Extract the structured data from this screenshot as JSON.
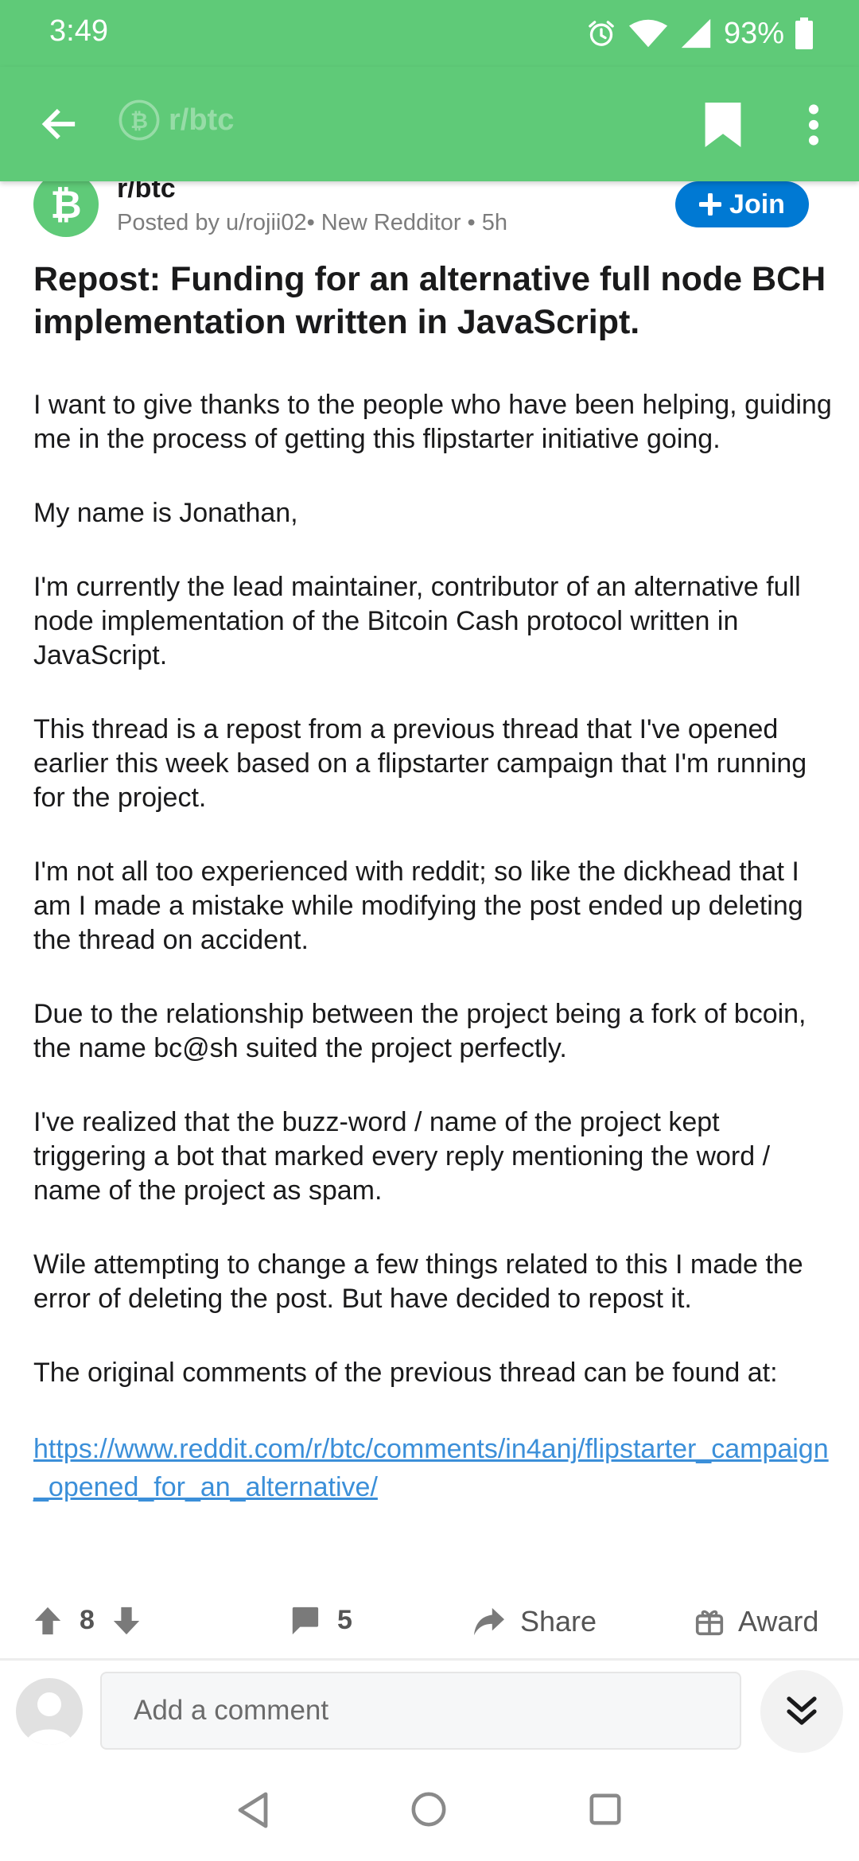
{
  "status_bar": {
    "time": "3:49",
    "battery": "93%",
    "icons": [
      "alarm-icon",
      "wifi-icon",
      "signal-icon",
      "battery-icon"
    ]
  },
  "app_bar": {
    "subreddit_label": "r/btc",
    "icons": [
      "back-arrow-icon",
      "bitcoin-cash-icon",
      "bookmark-icon",
      "more-vert-icon"
    ]
  },
  "post": {
    "subreddit": "r/btc",
    "meta": "Posted by u/rojii02• New Redditor • 5h",
    "join_label": "Join",
    "title": "Repost: Funding for an alternative full node BCH implementation written in JavaScript.",
    "paragraphs": [
      "I want to give thanks to the people who have been helping, guiding me in the process of getting this flipstarter initiative going.",
      "My name is Jonathan,",
      "I'm currently the lead maintainer, contributor of an alternative full node implementation of the Bitcoin Cash protocol written in JavaScript.",
      "This thread is a repost from a previous thread that I've opened earlier this week based on a flipstarter campaign that I'm running for the project.",
      "I'm not all too experienced with reddit; so like the dickhead that I am I made a mistake while modifying the post ended up deleting the thread on accident.",
      "Due to the relationship between the project being a fork of bcoin, the name bc@sh suited the project perfectly.",
      "I've realized that the buzz-word / name of the project kept triggering a bot that marked every reply mentioning the word / name of the project as spam.",
      "Wile attempting to change a few things related to this I made the error of deleting the post. But have decided to repost it.",
      "The original comments of the previous thread can be found at:"
    ],
    "link": "https://www.reddit.com/r/btc/comments/in4anj/flipstarter_campaign_opened_for_an_alternative/"
  },
  "actions": {
    "votes": "8",
    "comments": "5",
    "share_label": "Share",
    "award_label": "Award"
  },
  "comment_bar": {
    "placeholder": "Add a comment"
  },
  "colors": {
    "app_green": "#5fca78",
    "join_blue": "#0079d3",
    "link_blue": "#3b8fd9"
  }
}
